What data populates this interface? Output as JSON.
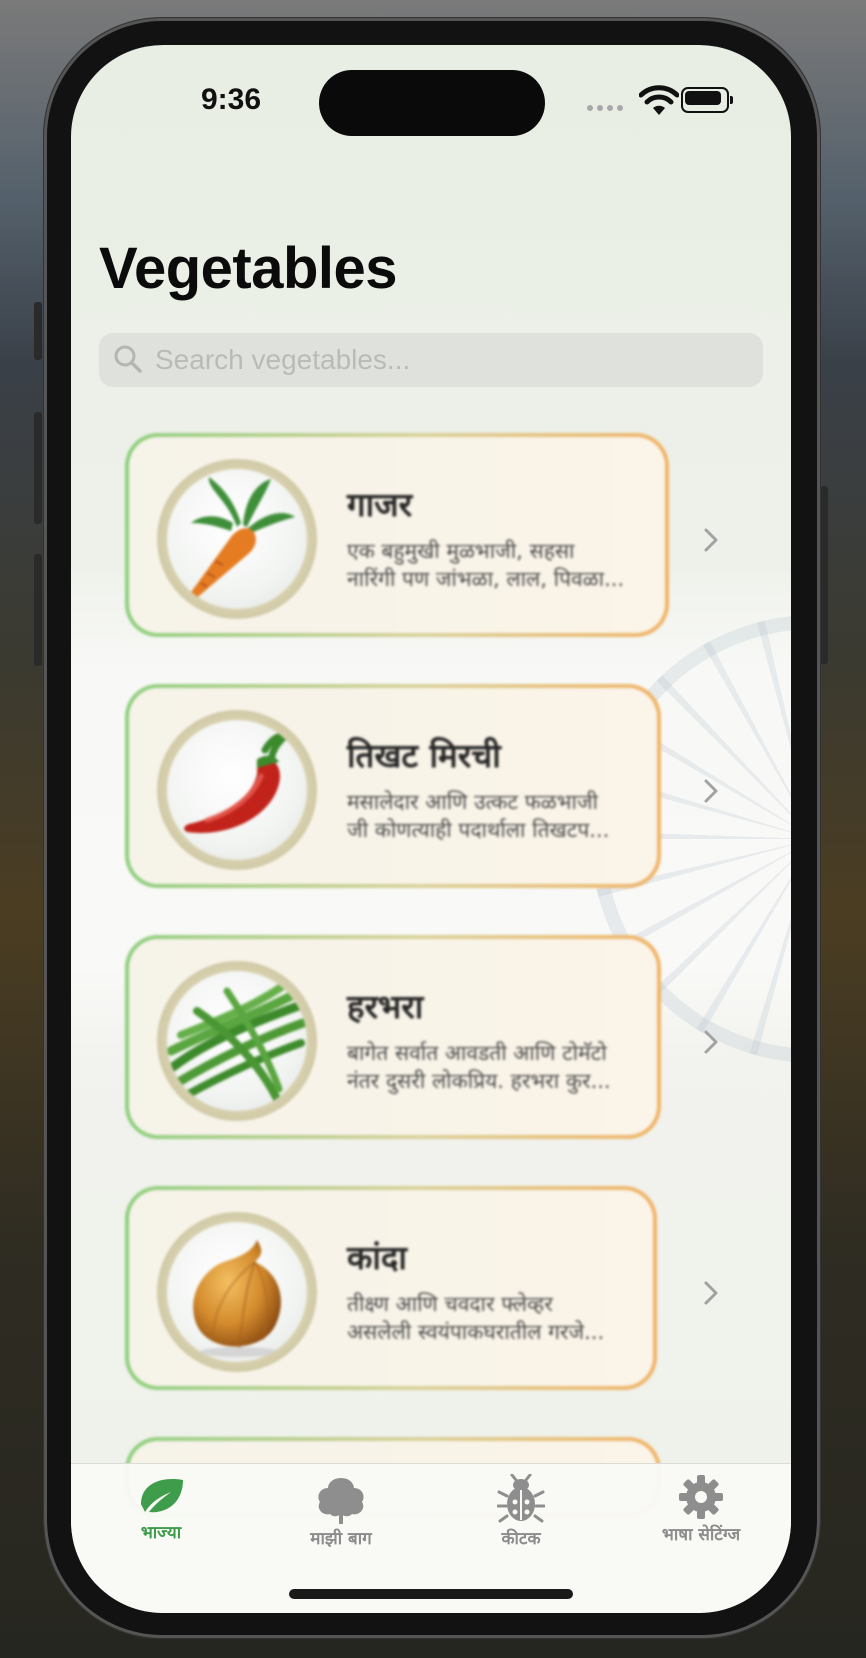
{
  "status_bar": {
    "time": "9:36"
  },
  "page": {
    "title": "Vegetables"
  },
  "search": {
    "placeholder": "Search vegetables..."
  },
  "vegetables": [
    {
      "name": "गाजर",
      "desc_line1": "एक बहुमुखी मुळभाजी, सहसा",
      "desc_line2": "नारिंगी पण जांभळा, लाल, पिवळा...",
      "icon": "carrot-icon"
    },
    {
      "name": "तिखट मिरची",
      "desc_line1": "मसालेदार आणि उत्कट फळभाजी",
      "desc_line2": "जी कोणत्याही पदार्थाला तिखटप...",
      "icon": "chili-pepper-icon"
    },
    {
      "name": "हरभरा",
      "desc_line1": "बागेत सर्वात आवडती आणि टोमॅटो",
      "desc_line2": "नंतर दुसरी लोकप्रिय. हरभरा कुर...",
      "icon": "green-beans-icon"
    },
    {
      "name": "कांदा",
      "desc_line1": "तीक्ष्ण आणि चवदार फ्लेव्हर",
      "desc_line2": "असलेली स्वयंपाकघरातील गरजे...",
      "icon": "onion-icon"
    }
  ],
  "tabbar": {
    "items": [
      {
        "label": "भाज्या",
        "icon": "leaf-icon",
        "active": true
      },
      {
        "label": "माझी बाग",
        "icon": "tree-icon",
        "active": false
      },
      {
        "label": "कीटक",
        "icon": "bug-icon",
        "active": false
      },
      {
        "label": "भाषा सेटिंग्ज",
        "icon": "gear-icon",
        "active": false
      }
    ]
  },
  "colors": {
    "accent_green": "#3f9c4a",
    "inactive_gray": "#8c8c8c",
    "card_border_start": "#8fcf7f",
    "card_border_end": "#f1b468"
  }
}
